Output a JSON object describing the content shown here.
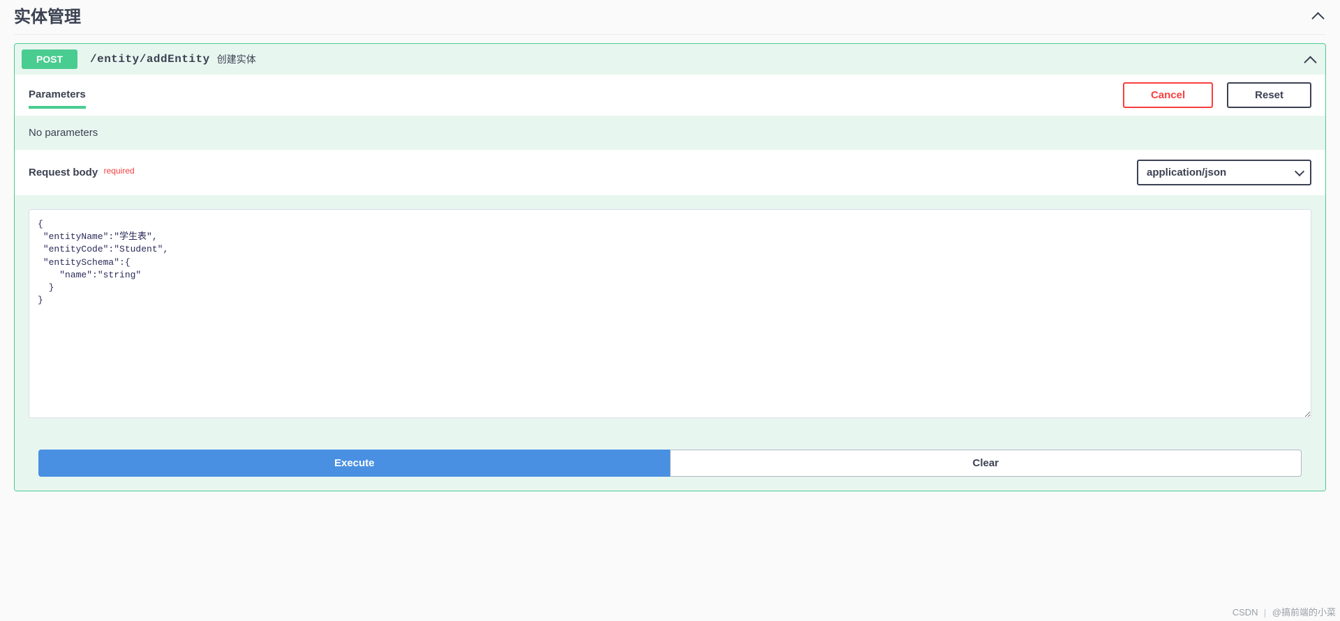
{
  "section": {
    "title": "实体管理"
  },
  "operation": {
    "method": "POST",
    "path": "/entity/addEntity",
    "description": "创建实体"
  },
  "parameters": {
    "tab_label": "Parameters",
    "cancel_label": "Cancel",
    "reset_label": "Reset",
    "empty_message": "No parameters"
  },
  "request_body": {
    "label": "Request body",
    "required_text": "required",
    "content_type": "application/json",
    "value": "{\n \"entityName\":\"学生表\",\n \"entityCode\":\"Student\",\n \"entitySchema\":{\n    \"name\":\"string\"\n  }\n}"
  },
  "actions": {
    "execute_label": "Execute",
    "clear_label": "Clear"
  },
  "watermark": {
    "site": "CSDN",
    "author": "@搞前端的小菜"
  }
}
